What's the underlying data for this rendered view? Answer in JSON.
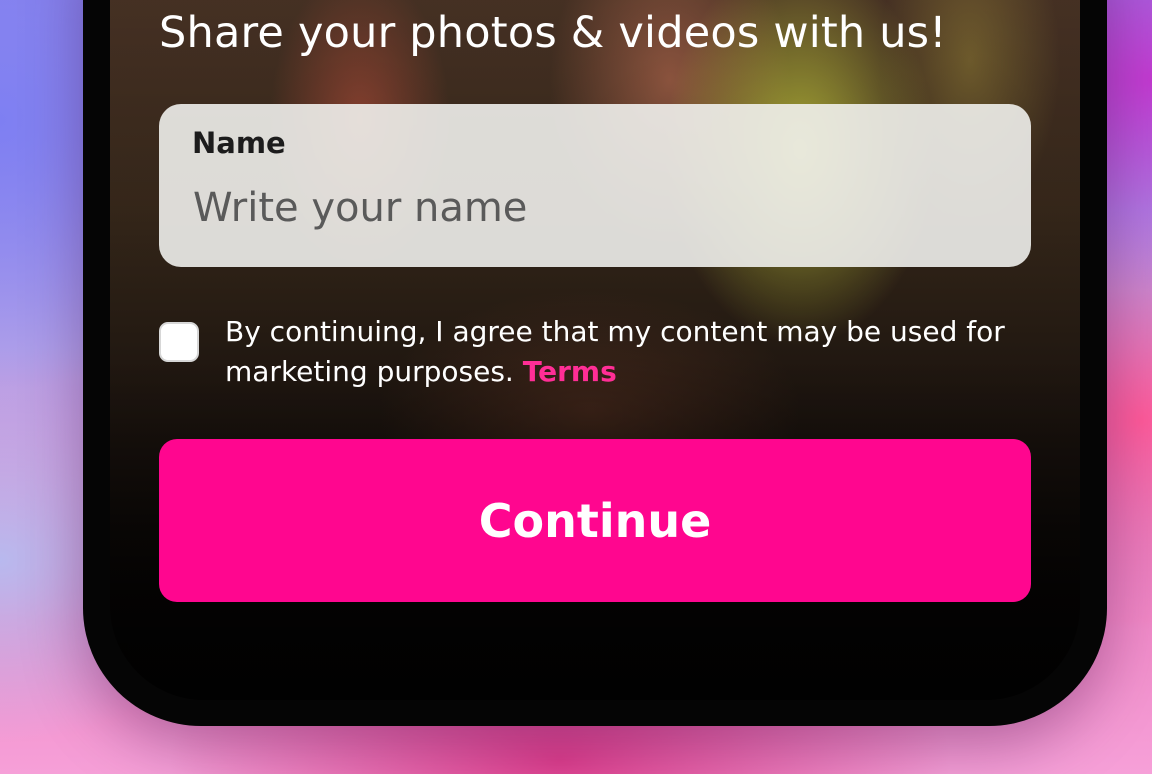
{
  "form": {
    "heading": "Share your photos & videos with us!",
    "name_label": "Name",
    "name_value": "",
    "name_placeholder": "Write your name",
    "consent_text": "By continuing, I agree that my content may be used for marketing purposes.",
    "terms_label": "Terms",
    "consent_checked": false,
    "continue_label": "Continue"
  },
  "colors": {
    "accent": "#ff068f",
    "terms_link": "#ff2e96",
    "input_bg": "#f0f0ec",
    "frame": "#050505"
  }
}
